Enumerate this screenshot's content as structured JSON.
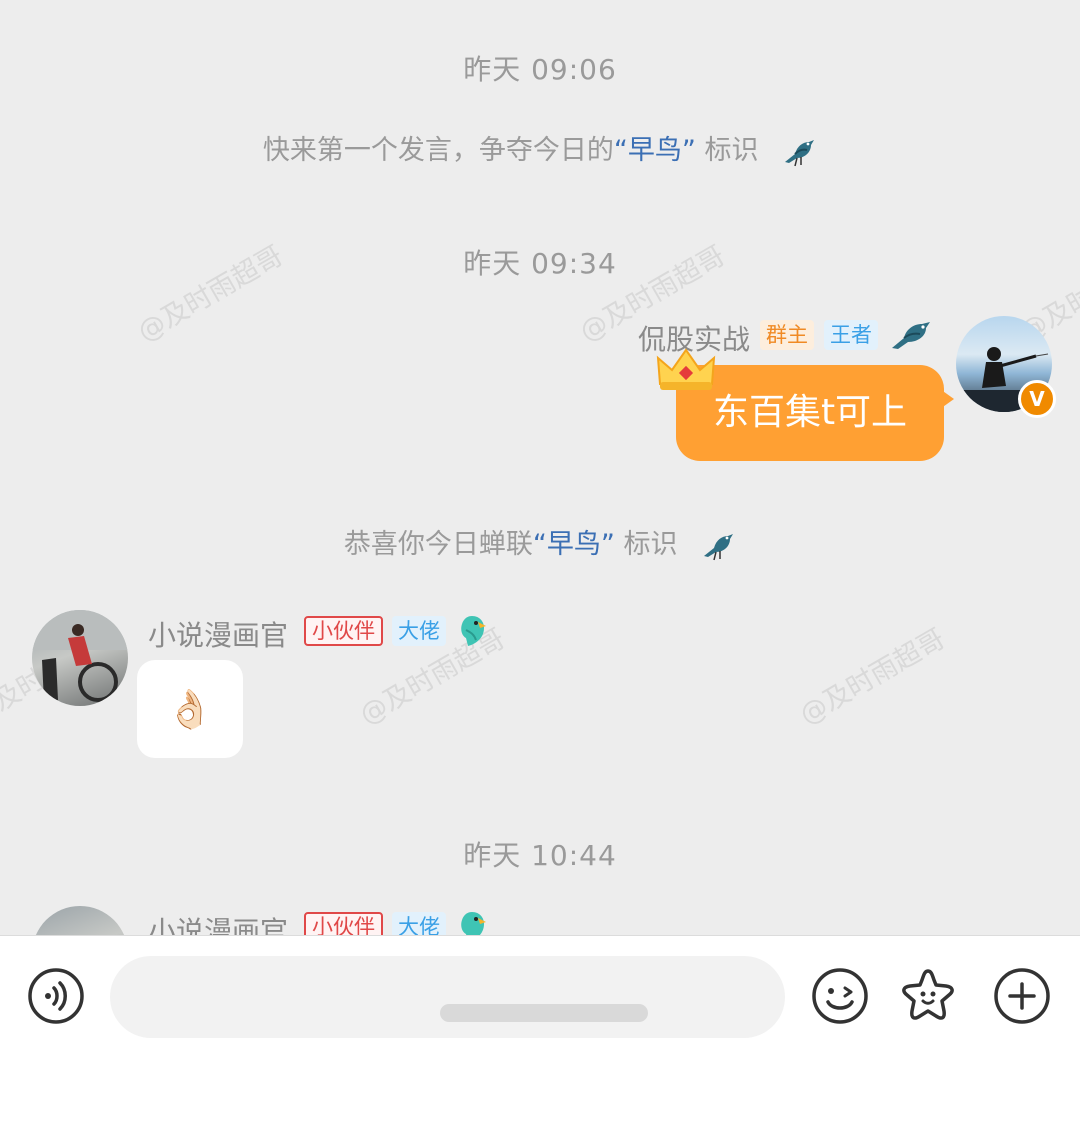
{
  "messages": {
    "ts1": "昨天 09:06",
    "sys1": {
      "before": "快来第一个发言，争夺今日的",
      "open_quote": "“",
      "highlight": "早鸟",
      "close_quote": "”",
      "after": "标识"
    },
    "ts2": "昨天 09:34",
    "self_msg": {
      "name": "侃股实战",
      "tag_owner": "群主",
      "tag_rank": "王者",
      "text": "东百集t可上"
    },
    "sys2": {
      "before": "恭喜你今日蝉联",
      "open_quote": "“",
      "highlight": "早鸟",
      "close_quote": "”",
      "after": "标识"
    },
    "other_msg": {
      "name": "小说漫画官",
      "tag_partner": "小伙伴",
      "tag_rank": "大佬",
      "emoji": "👌🏻"
    },
    "ts3": "昨天 10:44",
    "other_msg2": {
      "name": "小说漫画官",
      "tag_partner": "小伙伴",
      "tag_rank": "大佬"
    }
  },
  "watermark": "@及时雨超哥",
  "icons": {
    "voice": "voice-icon",
    "emoji": "emoji-icon",
    "sticker": "star-sticker-icon",
    "plus": "plus-icon"
  },
  "colors": {
    "bubble_self": "#ffa033",
    "owner_tag": "#f08a24",
    "rank_tag": "#3aa0e6",
    "partner_tag": "#e04848",
    "highlight": "#3b6fb4"
  }
}
